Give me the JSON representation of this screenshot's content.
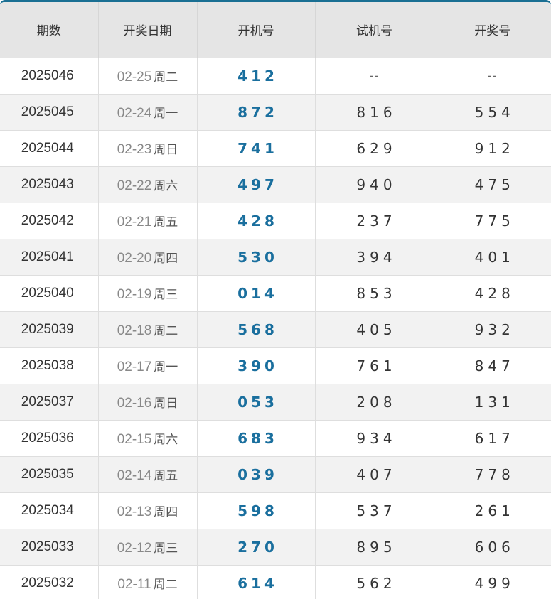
{
  "header": {
    "period": "期数",
    "date": "开奖日期",
    "open": "开机号",
    "test": "试机号",
    "prize": "开奖号"
  },
  "rows": [
    {
      "period": "2025046",
      "date": "02-25",
      "weekday": "周二",
      "open": "412",
      "test": "--",
      "prize": "--"
    },
    {
      "period": "2025045",
      "date": "02-24",
      "weekday": "周一",
      "open": "872",
      "test": "816",
      "prize": "554"
    },
    {
      "period": "2025044",
      "date": "02-23",
      "weekday": "周日",
      "open": "741",
      "test": "629",
      "prize": "912"
    },
    {
      "period": "2025043",
      "date": "02-22",
      "weekday": "周六",
      "open": "497",
      "test": "940",
      "prize": "475"
    },
    {
      "period": "2025042",
      "date": "02-21",
      "weekday": "周五",
      "open": "428",
      "test": "237",
      "prize": "775"
    },
    {
      "period": "2025041",
      "date": "02-20",
      "weekday": "周四",
      "open": "530",
      "test": "394",
      "prize": "401"
    },
    {
      "period": "2025040",
      "date": "02-19",
      "weekday": "周三",
      "open": "014",
      "test": "853",
      "prize": "428"
    },
    {
      "period": "2025039",
      "date": "02-18",
      "weekday": "周二",
      "open": "568",
      "test": "405",
      "prize": "932"
    },
    {
      "period": "2025038",
      "date": "02-17",
      "weekday": "周一",
      "open": "390",
      "test": "761",
      "prize": "847"
    },
    {
      "period": "2025037",
      "date": "02-16",
      "weekday": "周日",
      "open": "053",
      "test": "208",
      "prize": "131"
    },
    {
      "period": "2025036",
      "date": "02-15",
      "weekday": "周六",
      "open": "683",
      "test": "934",
      "prize": "617"
    },
    {
      "period": "2025035",
      "date": "02-14",
      "weekday": "周五",
      "open": "039",
      "test": "407",
      "prize": "778"
    },
    {
      "period": "2025034",
      "date": "02-13",
      "weekday": "周四",
      "open": "598",
      "test": "537",
      "prize": "261"
    },
    {
      "period": "2025033",
      "date": "02-12",
      "weekday": "周三",
      "open": "270",
      "test": "895",
      "prize": "606"
    },
    {
      "period": "2025032",
      "date": "02-11",
      "weekday": "周二",
      "open": "614",
      "test": "562",
      "prize": "499"
    }
  ],
  "colors": {
    "accent": "#1a6f9e",
    "header_bg": "#e5e5e5",
    "row_alt_bg": "#f2f2f2"
  }
}
